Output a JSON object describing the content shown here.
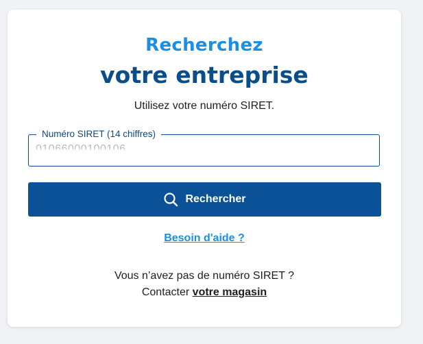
{
  "header": {
    "title_line1": "Recherchez",
    "title_line2": "votre entreprise",
    "subtitle": "Utilisez votre numéro SIRET."
  },
  "form": {
    "siret_label": "Numéro SIRET (14 chiffres)",
    "siret_value": "01066000100106",
    "search_button_label": "Rechercher",
    "search_icon": "search-icon"
  },
  "help": {
    "link_label": "Besoin d'aide ?"
  },
  "footer": {
    "no_siret_text": "Vous n’avez pas de numéro SIRET ?",
    "contact_prefix": "Contacter",
    "contact_link_label": "votre magasin"
  },
  "colors": {
    "accent_light": "#1a8fe3",
    "accent_dark": "#0a4d8c",
    "button_bg": "#0a5197",
    "page_bg": "#f1f2f6"
  }
}
